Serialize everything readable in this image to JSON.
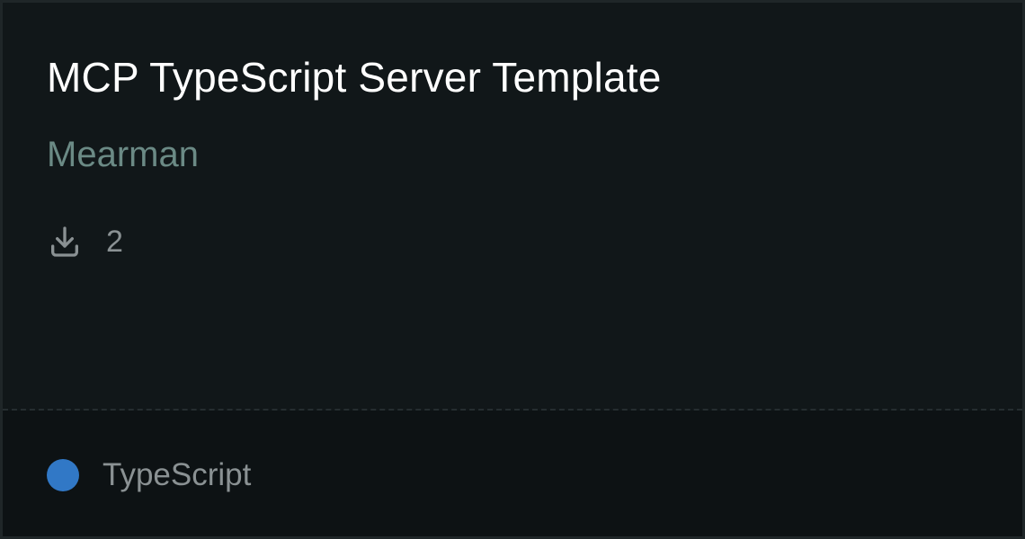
{
  "card": {
    "title": "MCP TypeScript Server Template",
    "author": "Mearman",
    "downloads": {
      "icon": "download-icon",
      "count": "2"
    },
    "language": {
      "name": "TypeScript",
      "color": "#3178c6"
    }
  }
}
